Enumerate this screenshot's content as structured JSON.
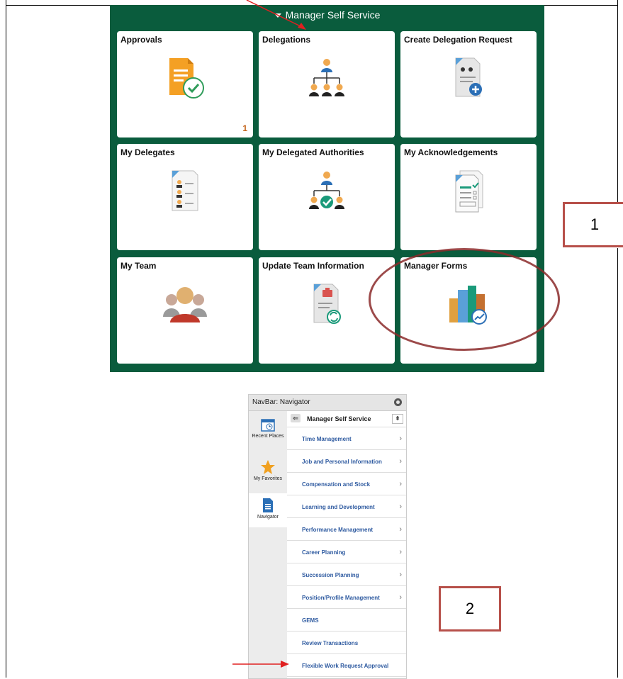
{
  "homepage": {
    "title": "Manager Self Service",
    "tiles": [
      {
        "title": "Approvals",
        "count": "1"
      },
      {
        "title": "Delegations"
      },
      {
        "title": "Create Delegation Request"
      },
      {
        "title": "My Delegates"
      },
      {
        "title": "My Delegated Authorities"
      },
      {
        "title": "My Acknowledgements"
      },
      {
        "title": "My Team"
      },
      {
        "title": "Update Team Information"
      },
      {
        "title": "Manager Forms"
      }
    ]
  },
  "callouts": {
    "one": "1",
    "two": "2"
  },
  "navbar": {
    "header": "NavBar: Navigator",
    "sidebar": [
      {
        "label": "Recent Places",
        "icon": "calendar-clock-icon"
      },
      {
        "label": "My Favorites",
        "icon": "star-icon"
      },
      {
        "label": "Navigator",
        "icon": "document-icon"
      }
    ],
    "breadcrumb": "Manager Self Service",
    "items": [
      {
        "label": "Time Management"
      },
      {
        "label": "Job and Personal Information"
      },
      {
        "label": "Compensation and Stock"
      },
      {
        "label": "Learning and Development"
      },
      {
        "label": "Performance Management"
      },
      {
        "label": "Career Planning"
      },
      {
        "label": "Succession Planning"
      },
      {
        "label": "Position/Profile Management"
      },
      {
        "label": "GEMS"
      },
      {
        "label": "Review Transactions"
      },
      {
        "label": "Flexible Work Request Approval"
      }
    ]
  },
  "colors": {
    "tile_bg_green": "#0a5c3d",
    "arrow_red": "#e02020",
    "link_blue": "#2e5aa0",
    "badge_orange": "#c4631a"
  }
}
